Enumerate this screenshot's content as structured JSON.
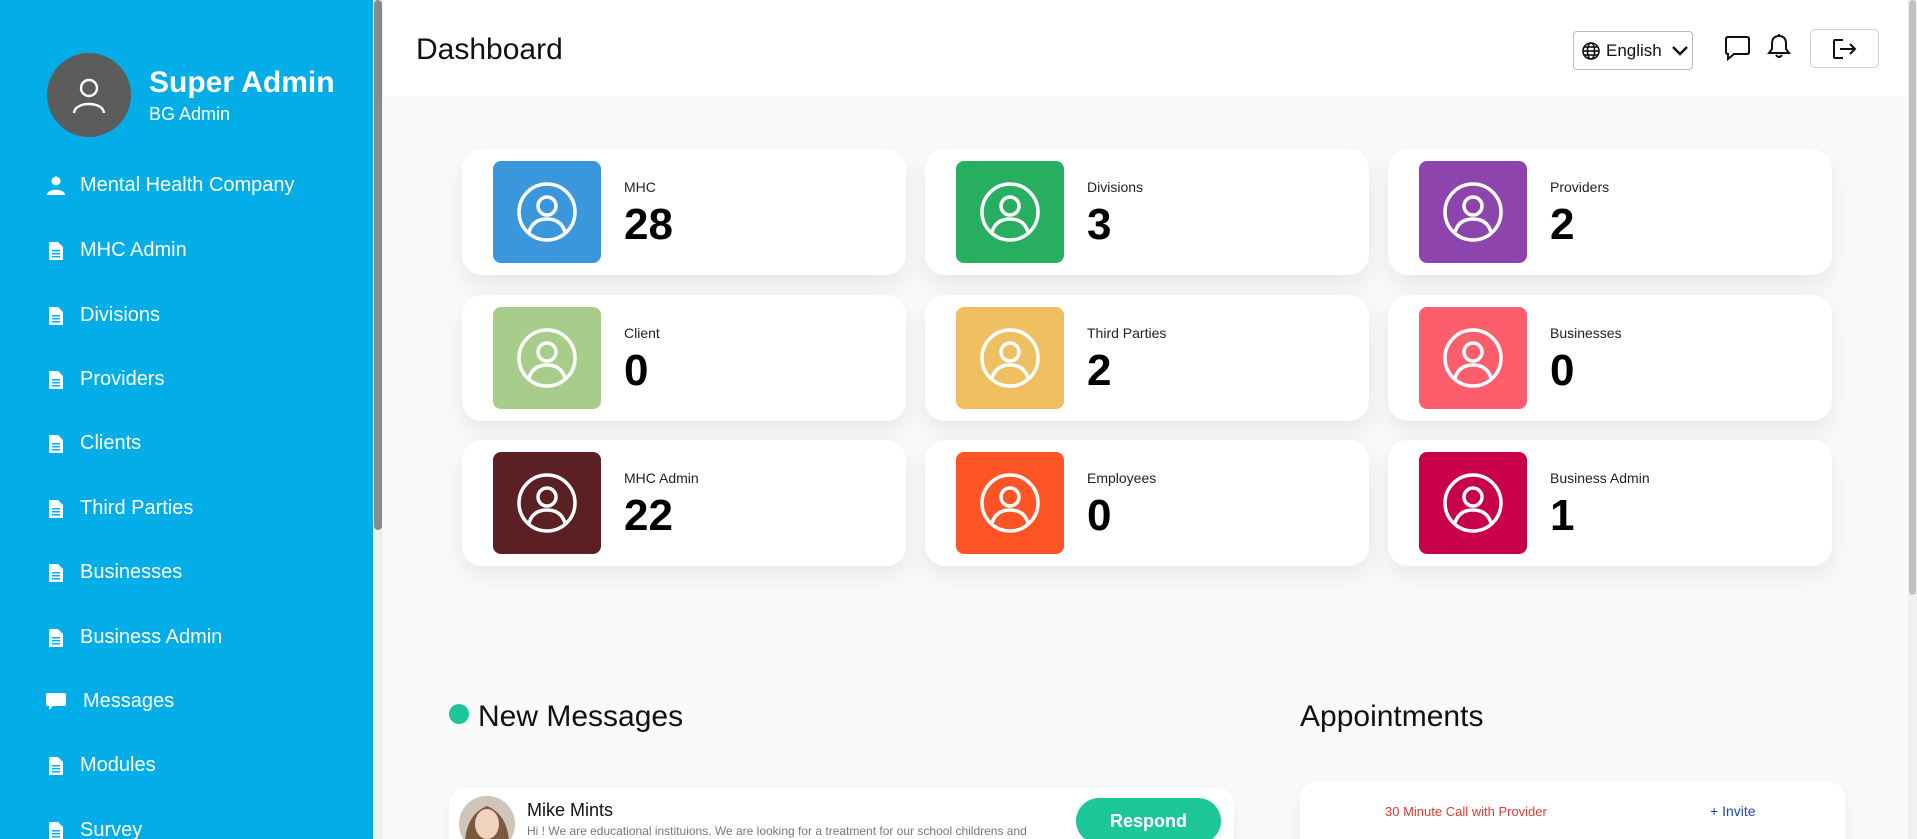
{
  "profile": {
    "name": "Super Admin",
    "role": "BG Admin"
  },
  "sidebar": {
    "items": [
      {
        "label": "Mental Health Company",
        "icon": "user-icon"
      },
      {
        "label": "MHC Admin",
        "icon": "document-icon"
      },
      {
        "label": "Divisions",
        "icon": "document-icon"
      },
      {
        "label": "Providers",
        "icon": "document-icon"
      },
      {
        "label": "Clients",
        "icon": "document-icon"
      },
      {
        "label": "Third Parties",
        "icon": "document-icon"
      },
      {
        "label": "Businesses",
        "icon": "document-icon"
      },
      {
        "label": "Business Admin",
        "icon": "document-icon"
      },
      {
        "label": "Messages",
        "icon": "chat-icon"
      },
      {
        "label": "Modules",
        "icon": "document-icon"
      },
      {
        "label": "Survey",
        "icon": "document-icon"
      }
    ]
  },
  "header": {
    "title": "Dashboard",
    "language": "English",
    "icons": [
      "globe-icon",
      "chat-icon",
      "bell-icon",
      "logout-icon"
    ]
  },
  "stats": [
    {
      "label": "MHC",
      "value": "28",
      "color": "#3b97dc"
    },
    {
      "label": "Divisions",
      "value": "3",
      "color": "#27ae60"
    },
    {
      "label": "Providers",
      "value": "2",
      "color": "#8e44ad"
    },
    {
      "label": "Client",
      "value": "0",
      "color": "#a8cd8a"
    },
    {
      "label": "Third Parties",
      "value": "2",
      "color": "#eec062"
    },
    {
      "label": "Businesses",
      "value": "0",
      "color": "#fd5e6c"
    },
    {
      "label": "MHC Admin",
      "value": "22",
      "color": "#5b2024"
    },
    {
      "label": "Employees",
      "value": "0",
      "color": "#ff5426"
    },
    {
      "label": "Business Admin",
      "value": "1",
      "color": "#c8004a"
    }
  ],
  "messages": {
    "title": "New Messages",
    "items": [
      {
        "name": "Mike Mints",
        "preview": "Hi ! We are educational instituions. We are looking for a treatment for our school childrens and",
        "action": "Respond"
      }
    ]
  },
  "appointments": {
    "title": "Appointments",
    "items": [
      {
        "title": "30 Minute Call with Provider",
        "action": "+ Invite"
      }
    ]
  },
  "colors": {
    "sidebar": "#03aee8",
    "accent": "#1dc79a"
  }
}
